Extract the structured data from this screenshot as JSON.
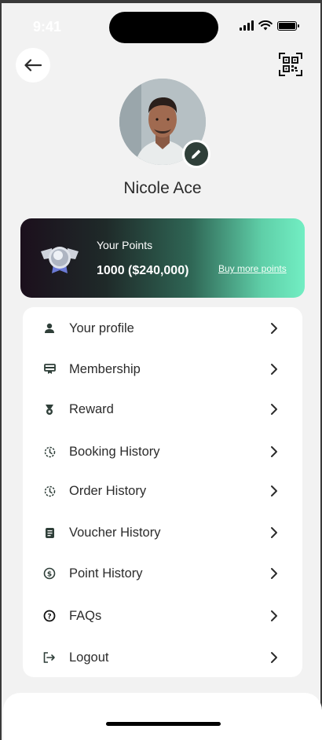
{
  "status_bar": {
    "time": "9:41"
  },
  "header": {
    "back_icon": "arrow-left-icon",
    "qr_icon": "qr-code-icon"
  },
  "profile": {
    "name": "Nicole Ace",
    "edit_icon": "pencil-icon"
  },
  "points": {
    "title": "Your Points",
    "value": "1000 ($240,000)",
    "buy_label": "Buy more points"
  },
  "menu": {
    "items": [
      {
        "label": "Your profile",
        "icon": "person-icon"
      },
      {
        "label": "Membership",
        "icon": "membership-card-icon"
      },
      {
        "label": "Reward",
        "icon": "medal-icon"
      },
      {
        "label": "Booking History",
        "icon": "history-clock-icon"
      },
      {
        "label": "Order History",
        "icon": "history-clock-icon"
      },
      {
        "label": "Voucher History",
        "icon": "receipt-icon"
      },
      {
        "label": "Point History",
        "icon": "dollar-circle-icon"
      },
      {
        "label": "FAQs",
        "icon": "question-circle-icon"
      },
      {
        "label": "Logout",
        "icon": "logout-icon"
      }
    ]
  },
  "colors": {
    "accent_dark": "#2f3f39",
    "card_gradient_end": "#72eec3",
    "background": "#f2f2f2"
  }
}
